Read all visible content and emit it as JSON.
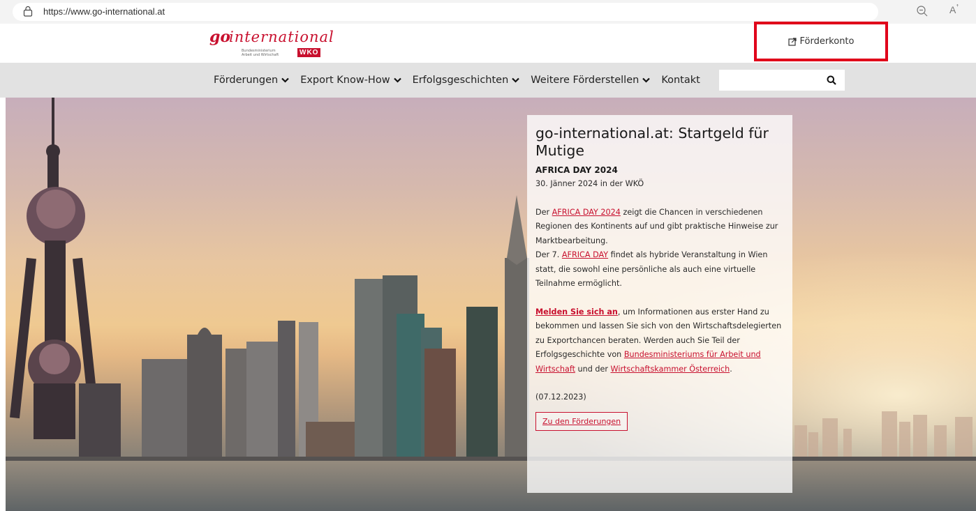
{
  "browser": {
    "url": "https://www.go-international.at"
  },
  "logo": {
    "go": "go",
    "international": "international",
    "ministry_line1": "Bundesministerium",
    "ministry_line2": "Arbeit und Wirtschaft",
    "wko": "WKO"
  },
  "header": {
    "account_link": "Förderkonto"
  },
  "nav": {
    "items": [
      {
        "label": "Förderungen",
        "dropdown": true
      },
      {
        "label": "Export Know-How",
        "dropdown": true
      },
      {
        "label": "Erfolgsgeschichten",
        "dropdown": true
      },
      {
        "label": "Weitere Förderstellen",
        "dropdown": true
      },
      {
        "label": "Kontakt",
        "dropdown": false
      }
    ],
    "search_value": ""
  },
  "card": {
    "title": "go-international.at: Startgeld für Mutige",
    "event_title": "AFRICA DAY 2024",
    "event_date": "30. Jänner 2024 in der WKÖ",
    "p1_pre": "Der ",
    "p1_link": "AFRICA DAY 2024",
    "p1_post": " zeigt die Chancen in verschiedenen Regionen des Kontinents auf und gibt praktische Hinweise zur Marktbearbeitung.",
    "p2_pre": "Der 7. ",
    "p2_link": "AFRICA DAY",
    "p2_post": " findet als hybride Veranstaltung in Wien statt, die sowohl eine persönliche als auch eine virtuelle Teilnahme ermöglicht.",
    "p3_link": "Melden Sie sich an",
    "p3_post": ", um Informationen aus erster Hand zu bekommen und lassen Sie sich von den Wirtschaftsdelegierten zu Exportchancen beraten. Werden auch Sie Teil der Erfolgsgeschichte von ",
    "p3_link2": "Bundesministeriums für Arbeit und Wirtschaft",
    "p3_mid": " und der ",
    "p3_link3": "Wirtschaftskammer Österreich",
    "p3_end": ".",
    "date": "(07.12.2023)",
    "cta": "Zu den Förderungen"
  },
  "colors": {
    "accent": "#c8102e",
    "highlight_box": "#e0001a",
    "nav_bg": "#e2e2e2"
  }
}
